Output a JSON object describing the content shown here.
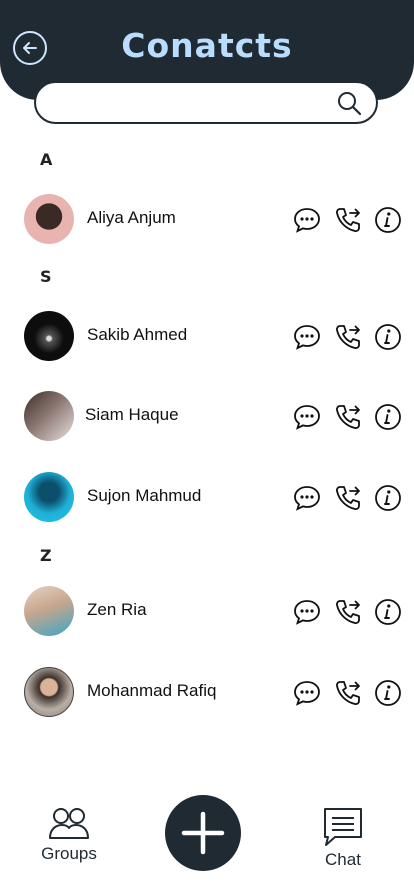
{
  "header": {
    "title": "Conatcts"
  },
  "search": {
    "placeholder": ""
  },
  "sections": [
    {
      "letter": "A"
    },
    {
      "letter": "S"
    },
    {
      "letter": "Z"
    }
  ],
  "contacts": [
    {
      "name": "Aliya Anjum",
      "avatar_color": "#e9b4b0"
    },
    {
      "name": "Sakib Ahmed",
      "avatar_color": "#1a1a1a"
    },
    {
      "name": "Siam Haque",
      "avatar_color": "#6b5a55"
    },
    {
      "name": "Sujon Mahmud",
      "avatar_color": "#1fb0d6"
    },
    {
      "name": "Zen Ria",
      "avatar_color": "#c6a58d"
    },
    {
      "name": "Mohanmad Rafiq",
      "avatar_color": "#8a7868"
    }
  ],
  "nav": {
    "groups_label": "Groups",
    "chat_label": "Chat"
  },
  "colors": {
    "header_bg": "#1f2a33",
    "title": "#b9dcff",
    "fab_bg": "#1f2a33"
  }
}
